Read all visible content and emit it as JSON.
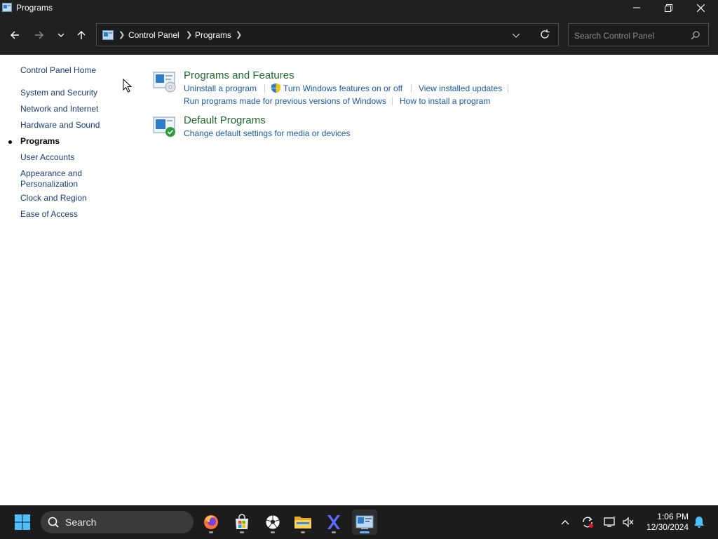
{
  "window": {
    "title": "Programs"
  },
  "address": {
    "crumbs": [
      "Control Panel",
      "Programs"
    ],
    "search_placeholder": "Search Control Panel"
  },
  "sidebar": {
    "home": "Control Panel Home",
    "items": [
      {
        "label": "System and Security"
      },
      {
        "label": "Network and Internet"
      },
      {
        "label": "Hardware and Sound"
      },
      {
        "label": "Programs",
        "active": true
      },
      {
        "label": "User Accounts"
      },
      {
        "label": "Appearance and\nPersonalization"
      },
      {
        "label": "Clock and Region"
      },
      {
        "label": "Ease of Access"
      }
    ]
  },
  "main": {
    "programs_features": {
      "title": "Programs and Features",
      "links": [
        "Uninstall a program",
        "Turn Windows features on or off",
        "View installed updates",
        "Run programs made for previous versions of Windows",
        "How to install a program"
      ]
    },
    "default_programs": {
      "title": "Default Programs",
      "links": [
        "Change default settings for media or devices"
      ]
    }
  },
  "taskbar": {
    "search_label": "Search",
    "time": "1:06 PM",
    "date": "12/30/2024",
    "apps": [
      "firefox-icon",
      "store-icon",
      "soccer-ball-icon",
      "file-explorer-icon",
      "x-app-icon",
      "control-panel-icon"
    ]
  },
  "colors": {
    "link": "#1a5aa6",
    "category_title": "#1e6b2b",
    "chrome": "#202020",
    "taskbar": "#1c1c1c",
    "active_indicator": "#5cb3ff"
  }
}
